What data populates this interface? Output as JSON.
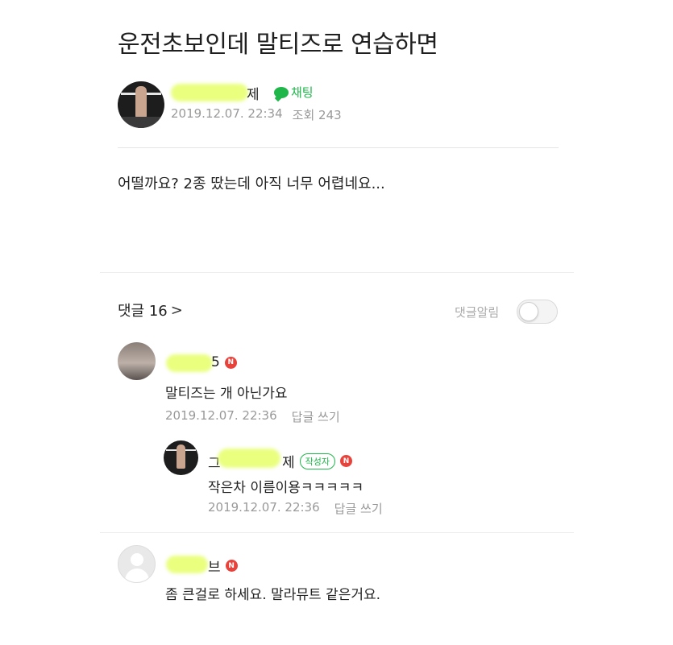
{
  "post": {
    "title": "운전초보인데 말티즈로 연습하면",
    "author_suffix": "제",
    "chat_label": "채팅",
    "date": "2019.12.07. 22:34",
    "views": "조회 243",
    "body": "어떨까요? 2종 땄는데 아직 너무 어렵네요..."
  },
  "comments_header": {
    "label": "댓글 16",
    "chevron": ">",
    "notify_label": "댓글알림"
  },
  "comments": [
    {
      "name_suffix": "5",
      "badge": "N",
      "text": "말티즈는 개 아닌가요",
      "date": "2019.12.07. 22:36",
      "reply_label": "답글 쓰기"
    },
    {
      "name_prefix": "그",
      "name_suffix": "제",
      "writer_badge": "작성자",
      "badge": "N",
      "text": "작은차 이름이용ㅋㅋㅋㅋㅋ",
      "date": "2019.12.07. 22:36",
      "reply_label": "답글 쓰기"
    },
    {
      "name_suffix": "브",
      "badge": "N",
      "text": "좀 큰걸로 하세요. 말라뮤트 같은거요."
    }
  ],
  "colors": {
    "accent_green": "#1fb74a",
    "badge_red": "#e8423b",
    "highlight_blur": "#e9ff78"
  }
}
